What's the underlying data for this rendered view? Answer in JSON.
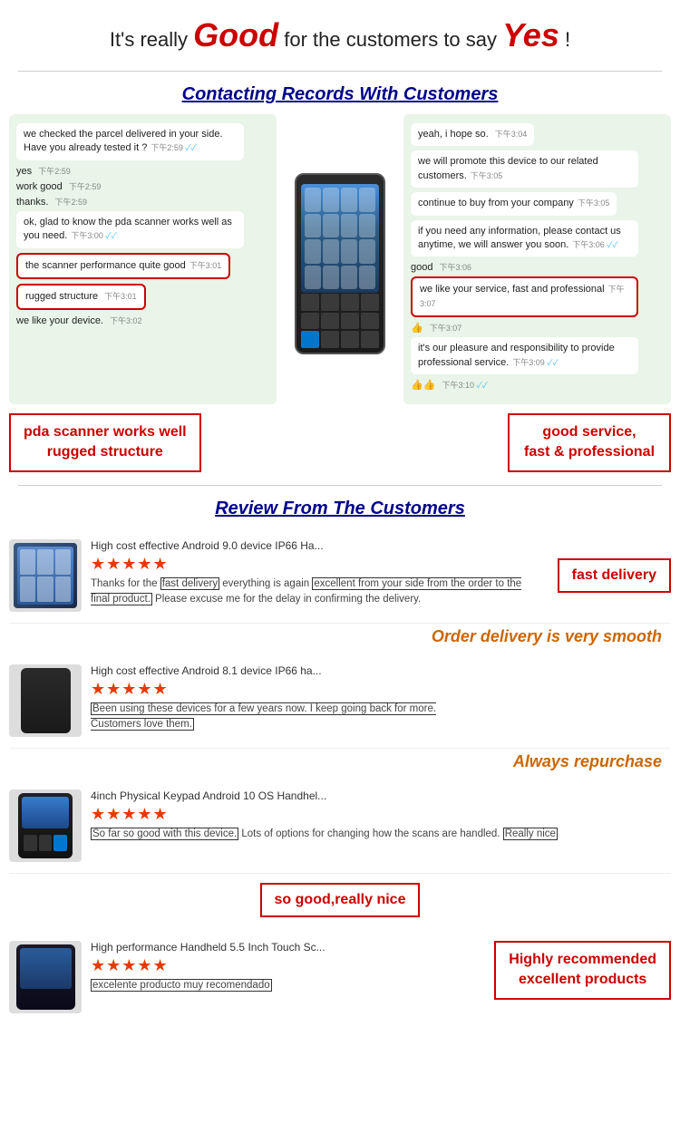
{
  "header": {
    "prefix": "It's really ",
    "good": "Good",
    "middle": " for the customers to say ",
    "yes": "Yes",
    "suffix": " !"
  },
  "contacting_section": {
    "title": "Contacting Records With Customers"
  },
  "chat_left": {
    "bubbles": [
      {
        "text": "we checked the parcel delivered in your side. Have you already tested it ?",
        "time": "下午2:59",
        "check": "✓✓"
      },
      {
        "text": "yes",
        "time": "下午2:59",
        "inline": true
      },
      {
        "text": "work good",
        "time": "下午2:59",
        "inline": true
      },
      {
        "text": "thanks.",
        "time": "下午2:59",
        "inline": true
      },
      {
        "text": "ok, glad to know the pda scanner works well as you need.",
        "time": "下午3:00",
        "check": "✓✓"
      },
      {
        "text": "the scanner performance quite good",
        "time": "下午3:01",
        "highlight": true
      },
      {
        "text": "rugged structure",
        "time": "下午3:01",
        "highlight": true
      },
      {
        "text": "we like your device.",
        "time": "下午3:02"
      }
    ]
  },
  "chat_right": {
    "bubbles": [
      {
        "text": "yeah, i hope so.",
        "time": "下午3:04"
      },
      {
        "text": "we will promote this device to our related customers.",
        "time": "下午3:05"
      },
      {
        "text": "continue to buy from your company",
        "time": "下午3:05"
      },
      {
        "text": "if you need any information, please contact us anytime, we will answer you soon.",
        "time": "下午3:06",
        "check": "✓✓"
      },
      {
        "text": "good",
        "time": "下午3:06",
        "inline": true
      },
      {
        "text": "we like your service, fast and professional",
        "time": "下午3:07",
        "highlight": true
      },
      {
        "text": "👍",
        "time": "下午3:07",
        "emoji": true
      },
      {
        "text": "it's our pleasure and responsibility to provide professional service.",
        "time": "下午3:09",
        "check": "✓✓"
      },
      {
        "text": "👍👍",
        "time": "下午3:10",
        "check": "✓✓",
        "emoji": true
      }
    ]
  },
  "callouts": {
    "left": {
      "line1": "pda scanner works well",
      "line2": "rugged structure"
    },
    "right": {
      "line1": "good service,",
      "line2": "fast & professional"
    }
  },
  "reviews_section": {
    "title": "Review From The Customers"
  },
  "reviews": [
    {
      "product": "High cost effective Android 9.0 device IP66 Ha...",
      "stars": "★★★★★",
      "text_parts": [
        {
          "text": "Thanks for the ",
          "highlight": false
        },
        {
          "text": "fast delivery",
          "highlight": true
        },
        {
          "text": " everything is again ",
          "highlight": false
        },
        {
          "text": "excellent from your side from the order to the final product.",
          "highlight": true
        },
        {
          "text": " Please excuse me for the delay in confirming the delivery.",
          "highlight": false
        }
      ],
      "callout": "fast delivery",
      "highlight_label": "Order delivery is very smooth"
    },
    {
      "product": "High cost effective Android 8.1 device IP66 ha...",
      "stars": "★★★★★",
      "text_parts": [
        {
          "text": "Been using these devices for a few years now.  I keep going back for more.\nCustomers love them.",
          "highlight": true
        }
      ],
      "highlight_label": "Always repurchase"
    },
    {
      "product": "4inch Physical Keypad Android 10 OS Handhel...",
      "stars": "★★★★★",
      "text_parts": [
        {
          "text": "So far so good with this device.",
          "highlight": true
        },
        {
          "text": " Lots of options for changing how the scans are handled. ",
          "highlight": false
        },
        {
          "text": "Really nice",
          "highlight": true
        }
      ],
      "highlight_label": "so good,really nice"
    },
    {
      "product": "High performance Handheld 5.5 Inch Touch Sc...",
      "stars": "★★★★★",
      "text_parts": [
        {
          "text": "excelente producto muy recomendado",
          "highlight": true
        }
      ],
      "callout_right": {
        "line1": "Highly recommended",
        "line2": "excellent products"
      }
    }
  ]
}
